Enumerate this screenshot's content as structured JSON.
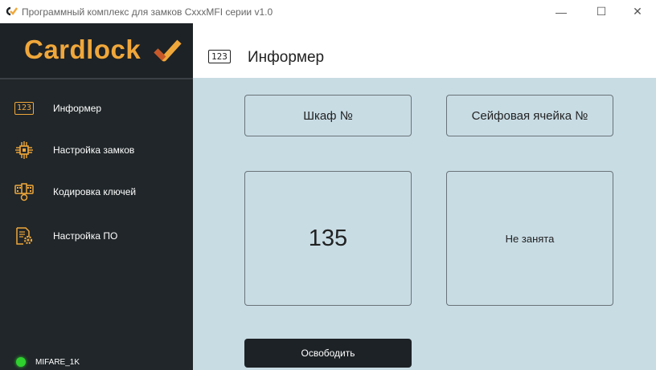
{
  "window": {
    "title": "Программный комплекс для замков CxxxMFI серии v1.0",
    "minimize": "—",
    "maximize": "☐",
    "close": "✕"
  },
  "logo": {
    "text": "Cardlock"
  },
  "sidebar": {
    "items": [
      {
        "label": "Информер",
        "icon": "123-icon",
        "badge": "123"
      },
      {
        "label": "Настройка замков",
        "icon": "chip-icon"
      },
      {
        "label": "Кодировка ключей",
        "icon": "key-card-icon"
      },
      {
        "label": "Настройка ПО",
        "icon": "document-gear-icon"
      }
    ],
    "status": {
      "label": "MIFARE_1K",
      "color": "#2fd12f"
    }
  },
  "header": {
    "badge": "123",
    "title": "Информер"
  },
  "main": {
    "cabinet_label": "Шкаф №",
    "cell_label": "Сейфовая ячейка №",
    "cabinet_value": "135",
    "cell_value": "Не занята",
    "release_button": "Освободить"
  },
  "colors": {
    "accent": "#f0a73a",
    "sidebar": "#202629",
    "main_bg": "#c8dce4"
  }
}
